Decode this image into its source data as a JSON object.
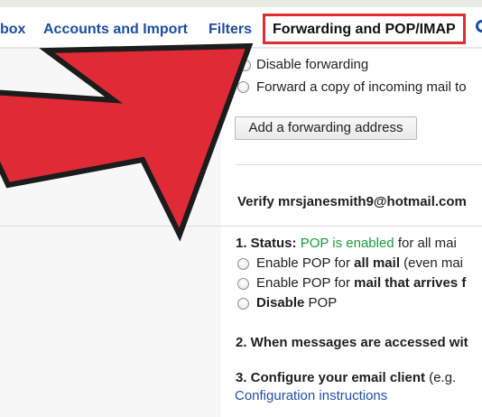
{
  "tabs": {
    "inbox_partial": "box",
    "accounts": "Accounts and Import",
    "filters": "Filters",
    "forwarding": "Forwarding and POP/IMAP"
  },
  "forwarding": {
    "disable_label": "Disable forwarding",
    "forward_copy_label": "Forward a copy of incoming mail to",
    "add_button": "Add a forwarding address"
  },
  "verify": {
    "text": "Verify mrsjanesmith9@hotmail.com"
  },
  "pop": {
    "status_prefix": "1. Status: ",
    "status_value": "POP is enabled",
    "status_suffix": " for all mai",
    "enable_all_prefix": "Enable POP for ",
    "enable_all_bold": "all mail",
    "enable_all_suffix": " (even mai",
    "enable_from_prefix": "Enable POP for ",
    "enable_from_bold": "mail that arrives f",
    "disable_bold": "Disable",
    "disable_suffix": " POP",
    "accessed_text": "2. When messages are accessed wit",
    "configure_bold": "3. Configure your email client",
    "configure_suffix": " (e.g. ",
    "config_link": "Configuration instructions"
  },
  "colors": {
    "highlight_border": "#de2e2e",
    "arrow_fill": "#e02a36",
    "status_green": "#179c38",
    "link_blue": "#1f4fa8"
  }
}
